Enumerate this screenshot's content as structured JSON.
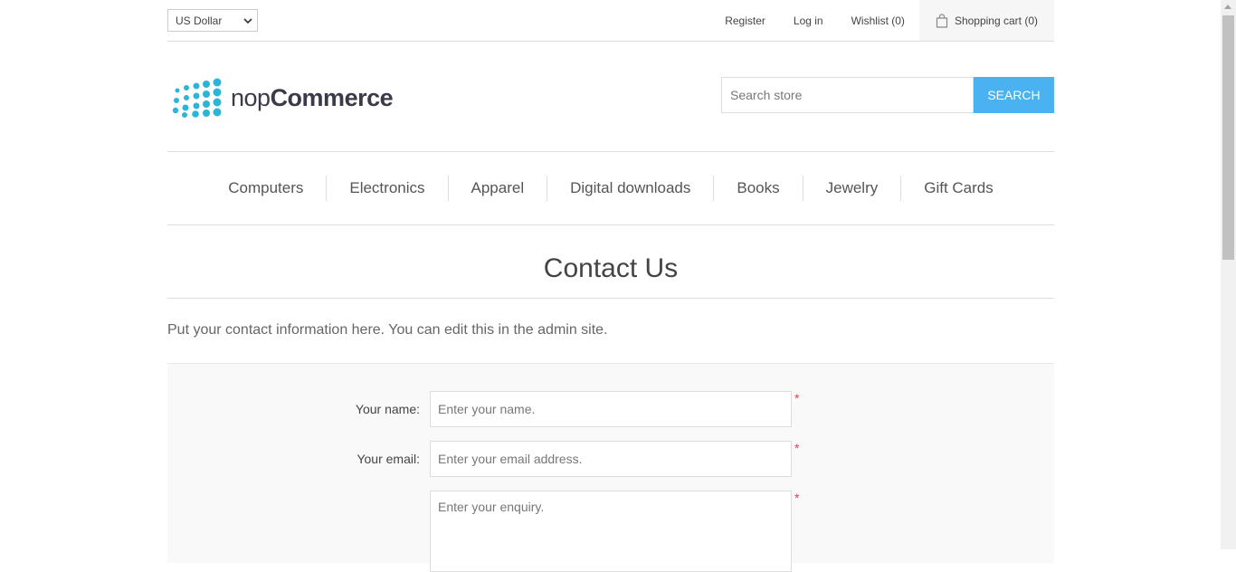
{
  "header": {
    "currency": "US Dollar",
    "links": [
      "Register",
      "Log in",
      "Wishlist (0)"
    ],
    "cart": "Shopping cart (0)"
  },
  "logo": {
    "light": "nop",
    "bold": "Commerce"
  },
  "search": {
    "placeholder": "Search store",
    "button": "SEARCH"
  },
  "menu": [
    "Computers",
    "Electronics",
    "Apparel",
    "Digital downloads",
    "Books",
    "Jewelry",
    "Gift Cards"
  ],
  "page": {
    "title": "Contact Us",
    "intro": "Put your contact information here. You can edit this in the admin site."
  },
  "form": {
    "name_label": "Your name:",
    "name_placeholder": "Enter your name.",
    "email_label": "Your email:",
    "email_placeholder": "Enter your email address.",
    "enquiry_placeholder": "Enter your enquiry.",
    "required_mark": "*"
  },
  "colors": {
    "accent": "#4ab2f1",
    "logo": "#2bb6d8",
    "required": "#e4434b"
  }
}
